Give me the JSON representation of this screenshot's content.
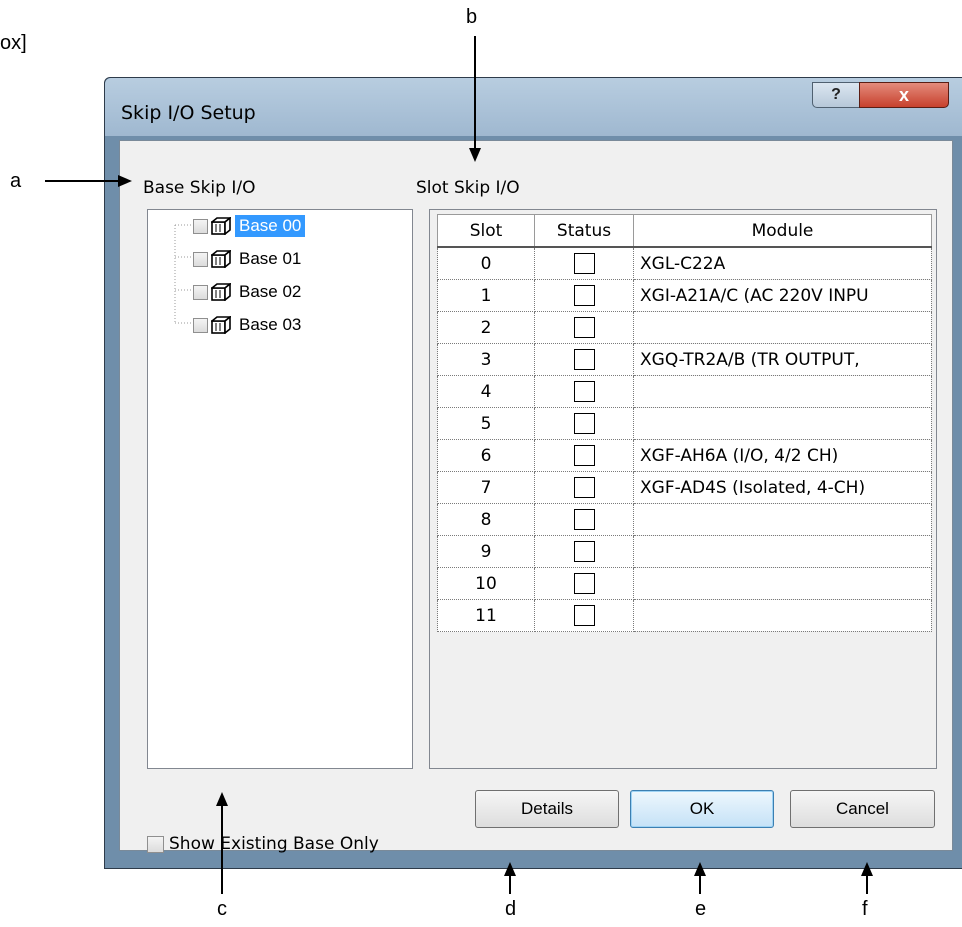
{
  "corner_text": "ox]",
  "callouts": {
    "a": "a",
    "b": "b",
    "c": "c",
    "d": "d",
    "e": "e",
    "f": "f"
  },
  "dialog": {
    "title": "Skip I/O Setup",
    "help_label": "?",
    "close_label": "x",
    "base_label": "Base Skip I/O",
    "slot_label": "Slot Skip I/O",
    "tree": [
      "Base 00",
      "Base 01",
      "Base 02",
      "Base 03"
    ],
    "columns": {
      "slot": "Slot",
      "status": "Status",
      "module": "Module"
    },
    "rows": [
      {
        "slot": "0",
        "module": "XGL-C22A"
      },
      {
        "slot": "1",
        "module": "XGI-A21A/C (AC 220V INPU"
      },
      {
        "slot": "2",
        "module": ""
      },
      {
        "slot": "3",
        "module": "XGQ-TR2A/B (TR OUTPUT,"
      },
      {
        "slot": "4",
        "module": ""
      },
      {
        "slot": "5",
        "module": ""
      },
      {
        "slot": "6",
        "module": "XGF-AH6A (I/O, 4/2 CH)"
      },
      {
        "slot": "7",
        "module": "XGF-AD4S (Isolated, 4-CH)"
      },
      {
        "slot": "8",
        "module": ""
      },
      {
        "slot": "9",
        "module": ""
      },
      {
        "slot": "10",
        "module": ""
      },
      {
        "slot": "11",
        "module": ""
      }
    ],
    "show_existing_label": "Show Existing Base Only",
    "buttons": {
      "details": "Details",
      "ok": "OK",
      "cancel": "Cancel"
    }
  }
}
